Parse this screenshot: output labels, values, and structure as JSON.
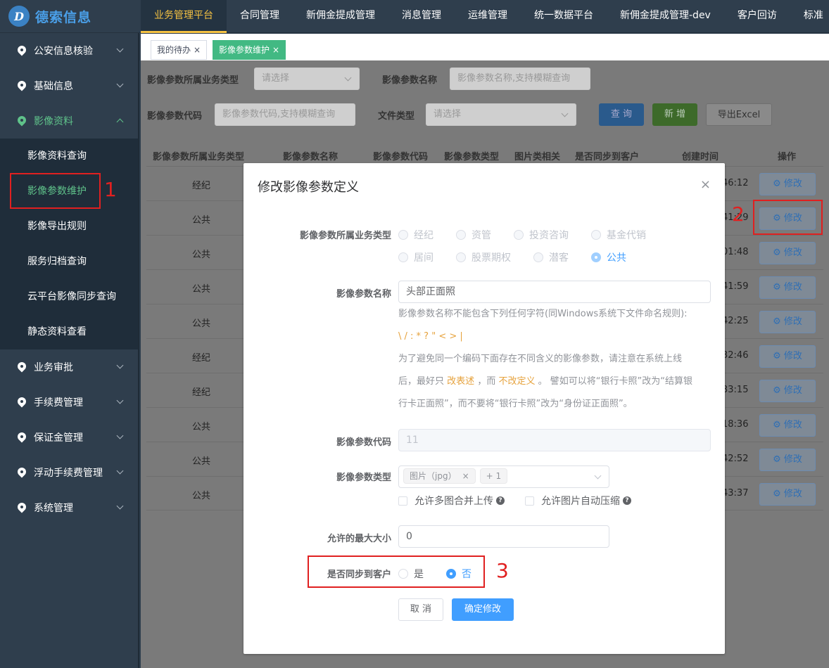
{
  "app": {
    "logo_mark": "D",
    "logo_text": "德索信息"
  },
  "top_nav": [
    "业务管理平台",
    "合同管理",
    "新佣金提成管理",
    "消息管理",
    "运维管理",
    "统一数据平台",
    "新佣金提成管理-dev",
    "客户回访",
    "标准"
  ],
  "sidebar": {
    "groups_top": [
      "公安信息核验",
      "基础信息"
    ],
    "open_group": "影像资料",
    "sub_items": [
      "影像资料查询",
      "影像参数维护",
      "影像导出规则",
      "服务归档查询",
      "云平台影像同步查询",
      "静态资料查看"
    ],
    "groups_bottom": [
      "业务审批",
      "手续费管理",
      "保证金管理",
      "浮动手续费管理",
      "系统管理"
    ]
  },
  "tabs": [
    {
      "label": "我的待办",
      "close": "×"
    },
    {
      "label": "影像参数维护",
      "close": "×"
    }
  ],
  "filters": {
    "biz_type_label": "影像参数所属业务类型",
    "biz_type_placeholder": "请选择",
    "name_label": "影像参数名称",
    "name_placeholder": "影像参数名称,支持模糊查询",
    "code_label": "影像参数代码",
    "code_placeholder": "影像参数代码,支持模糊查询",
    "file_type_label": "文件类型",
    "file_type_placeholder": "请选择",
    "query_btn": "查 询",
    "add_btn": "新 增",
    "export_btn": "导出Excel"
  },
  "table": {
    "headers": [
      "影像参数所属业务类型",
      "影像参数名称",
      "影像参数代码",
      "影像参数类型",
      "图片类相关",
      "是否同步到客户",
      "创建时间",
      "操作"
    ],
    "rows": [
      {
        "biz": "经纪",
        "time": "46:12"
      },
      {
        "biz": "公共",
        "time": "41:29"
      },
      {
        "biz": "公共",
        "time": "01:48"
      },
      {
        "biz": "公共",
        "time": "41:59"
      },
      {
        "biz": "公共",
        "time": "42:25"
      },
      {
        "biz": "经纪",
        "time": "32:46"
      },
      {
        "biz": "经纪",
        "time": "33:15"
      },
      {
        "biz": "公共",
        "time": "18:36"
      },
      {
        "biz": "公共",
        "time": "42:52"
      },
      {
        "biz": "公共",
        "time": "43:37"
      }
    ],
    "edit_label": "修改"
  },
  "modal": {
    "title": "修改影像参数定义",
    "close": "×",
    "biz_type_label": "影像参数所属业务类型",
    "biz_options": [
      "经纪",
      "资管",
      "投资咨询",
      "基金代销",
      "居间",
      "股票期权",
      "潜客",
      "公共"
    ],
    "name_label": "影像参数名称",
    "name_value": "头部正面照",
    "hint_line1": "影像参数名称不能包含下列任何字符(同Windows系统下文件命名规则):",
    "hint_chars": "\\ / : * ? \" < > |",
    "hint_line2": "为了避免同一个编码下面存在不同含义的影像参数，请注意在系统上线",
    "hint_line3a": "后，最好只",
    "hint_line3b": "改表述",
    "hint_line3c": "，而",
    "hint_line3d": "不改定义",
    "hint_line3e": "。 譬如可以将“银行卡照”改为“结算银",
    "hint_line4": "行卡正面照”，而不要将“银行卡照”改为“身份证正面照”。",
    "code_label": "影像参数代码",
    "code_value": "11",
    "type_label": "影像参数类型",
    "type_tag": "图片（jpg）",
    "type_tag_close": "×",
    "type_more": "+ 1",
    "multi_merge": "允许多图合并上传",
    "auto_compress": "允许图片自动压缩",
    "help": "?",
    "max_size_label": "允许的最大大小",
    "max_size_value": "0",
    "sync_label": "是否同步到客户",
    "sync_yes": "是",
    "sync_no": "否",
    "cancel_btn": "取 消",
    "confirm_btn": "确定修改"
  },
  "annotations": [
    "1",
    "2",
    "3"
  ],
  "colors": {
    "accent_green": "#42b983",
    "primary_blue": "#409eff",
    "nav_highlight": "#f5c242",
    "annotation_red": "#e02020"
  }
}
